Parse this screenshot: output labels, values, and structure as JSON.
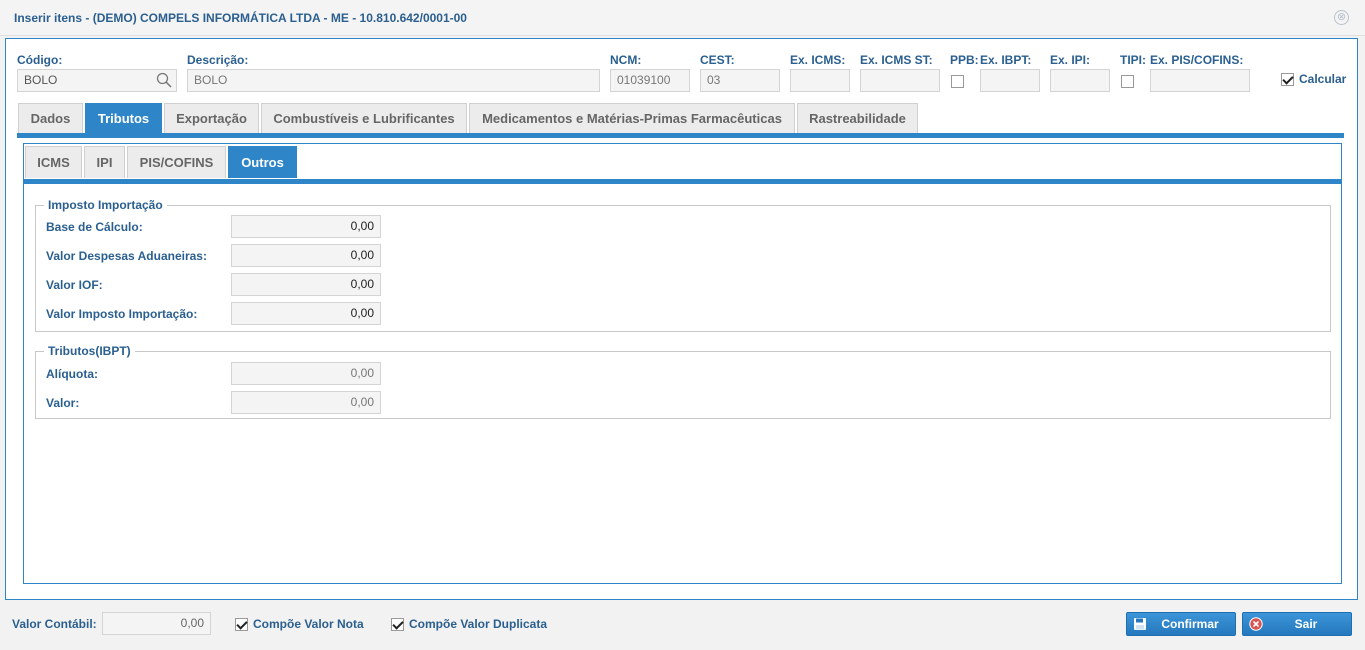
{
  "window": {
    "title": "Inserir itens - (DEMO) COMPELS INFORMÁTICA LTDA - ME - 10.810.642/0001-00",
    "close_glyph": "⊗"
  },
  "header": {
    "codigo": {
      "label": "Código:",
      "value": "BOLO"
    },
    "descricao": {
      "label": "Descrição:",
      "value": "BOLO"
    },
    "ncm": {
      "label": "NCM:",
      "value": "01039100"
    },
    "cest": {
      "label": "CEST:",
      "value": "03"
    },
    "ex_icms": {
      "label": "Ex. ICMS:",
      "value": ""
    },
    "ex_icms_st": {
      "label": "Ex. ICMS ST:",
      "value": ""
    },
    "ppb": {
      "label": "PPB:",
      "checked": false
    },
    "ex_ibpt": {
      "label": "Ex. IBPT:",
      "value": ""
    },
    "ex_ipi": {
      "label": "Ex. IPI:",
      "value": ""
    },
    "tipi": {
      "label": "TIPI:",
      "checked": false
    },
    "ex_pis_cofins": {
      "label": "Ex. PIS/COFINS:",
      "value": ""
    },
    "calcular": {
      "label": "Calcular",
      "checked": true
    }
  },
  "tabs": [
    {
      "label": "Dados",
      "active": false
    },
    {
      "label": "Tributos",
      "active": true
    },
    {
      "label": "Exportação",
      "active": false
    },
    {
      "label": "Combustíveis e Lubrificantes",
      "active": false
    },
    {
      "label": "Medicamentos e Matérias-Primas Farmacêuticas",
      "active": false
    },
    {
      "label": "Rastreabilidade",
      "active": false
    }
  ],
  "subtabs": [
    {
      "label": "ICMS",
      "active": false
    },
    {
      "label": "IPI",
      "active": false
    },
    {
      "label": "PIS/COFINS",
      "active": false
    },
    {
      "label": "Outros",
      "active": true
    }
  ],
  "imposto_importacao": {
    "legend": "Imposto Importação",
    "fields": [
      {
        "label": "Base de Cálculo:",
        "value": "0,00"
      },
      {
        "label": "Valor Despesas Aduaneiras:",
        "value": "0,00"
      },
      {
        "label": "Valor IOF:",
        "value": "0,00"
      },
      {
        "label": "Valor Imposto Importação:",
        "value": "0,00"
      }
    ]
  },
  "tributos_ibpt": {
    "legend": "Tributos(IBPT)",
    "fields": [
      {
        "label": "Alíquota:",
        "value": "0,00"
      },
      {
        "label": "Valor:",
        "value": "0,00"
      }
    ]
  },
  "footer": {
    "valor_contabil": {
      "label": "Valor Contábil:",
      "value": "0,00"
    },
    "compoe_valor_nota": {
      "label": "Compõe Valor Nota",
      "checked": true
    },
    "compoe_valor_duplicata": {
      "label": "Compõe Valor Duplicata",
      "checked": true
    },
    "confirmar_label": "Confirmar",
    "sair_label": "Sair"
  },
  "colors": {
    "accent": "#2e86c9",
    "label": "#2a5f8f",
    "danger": "#d9534f"
  },
  "icons": {
    "search": "search-icon",
    "close": "close-icon",
    "save": "save-icon",
    "exit": "exit-icon"
  }
}
